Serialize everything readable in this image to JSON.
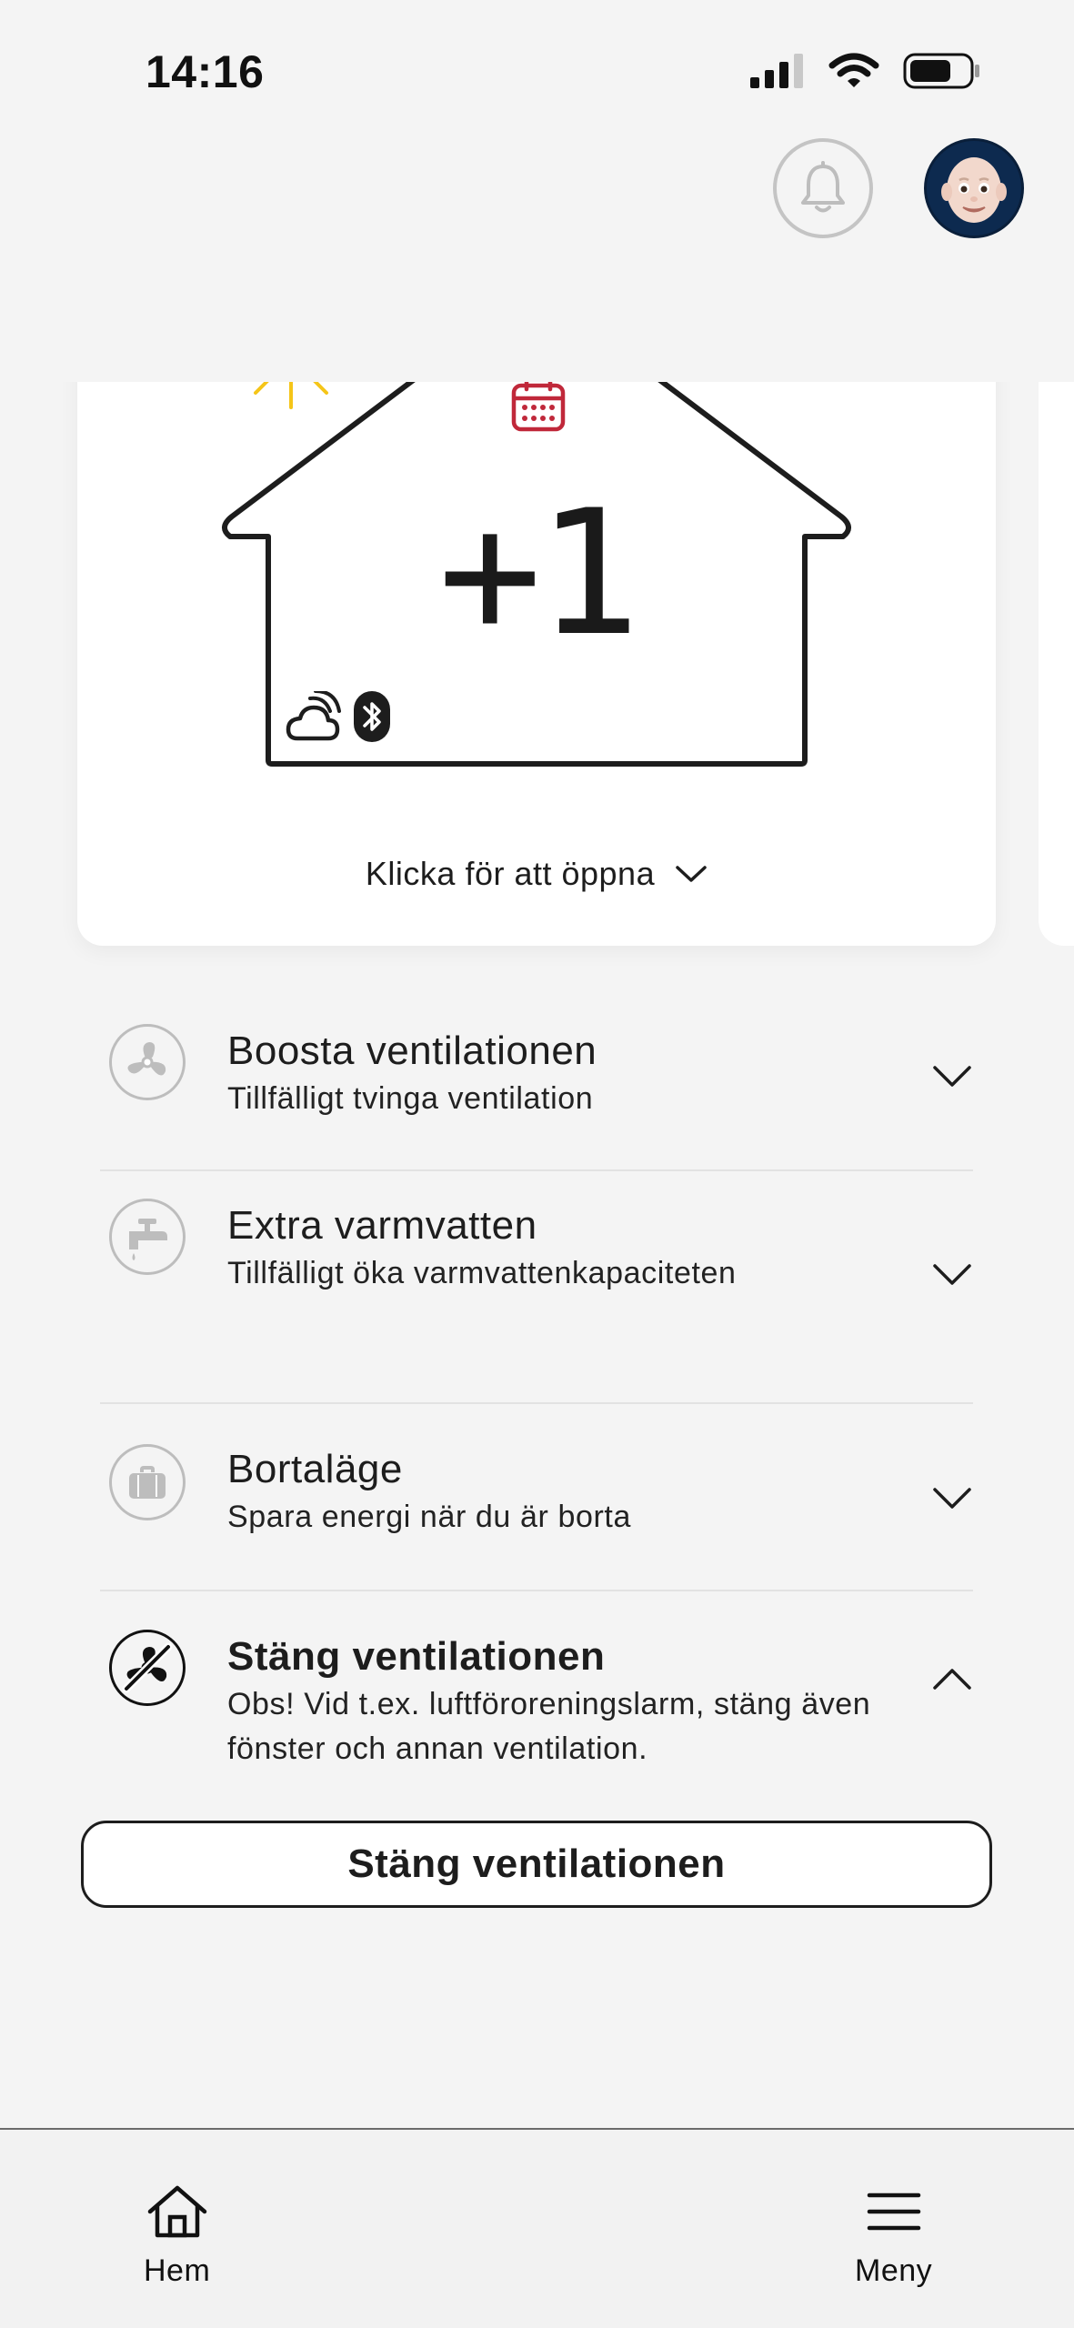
{
  "status": {
    "time": "14:16"
  },
  "house": {
    "value": "+1",
    "open_label": "Klicka för att öppna"
  },
  "options": [
    {
      "title": "Boosta ventilationen",
      "subtitle": "Tillfälligt tvinga ventilation",
      "icon": "fan-icon"
    },
    {
      "title": "Extra varmvatten",
      "subtitle": "Tillfälligt öka varmvattenkapaciteten",
      "icon": "faucet-icon"
    },
    {
      "title": "Bortaläge",
      "subtitle": "Spara energi när du är borta",
      "icon": "suitcase-icon"
    },
    {
      "title": "Stäng ventilationen",
      "subtitle": "Obs! Vid t.ex. luftföroreningslarm, stäng även fönster och annan ventilation.",
      "icon": "fan-off-icon"
    }
  ],
  "close_ventilation_button": "Stäng ventilationen",
  "nav": {
    "home_label": "Hem",
    "menu_label": "Meny"
  },
  "colors": {
    "calendar_accent": "#c0283a",
    "sun_accent": "#f5c518",
    "background": "#f4f4f4"
  }
}
